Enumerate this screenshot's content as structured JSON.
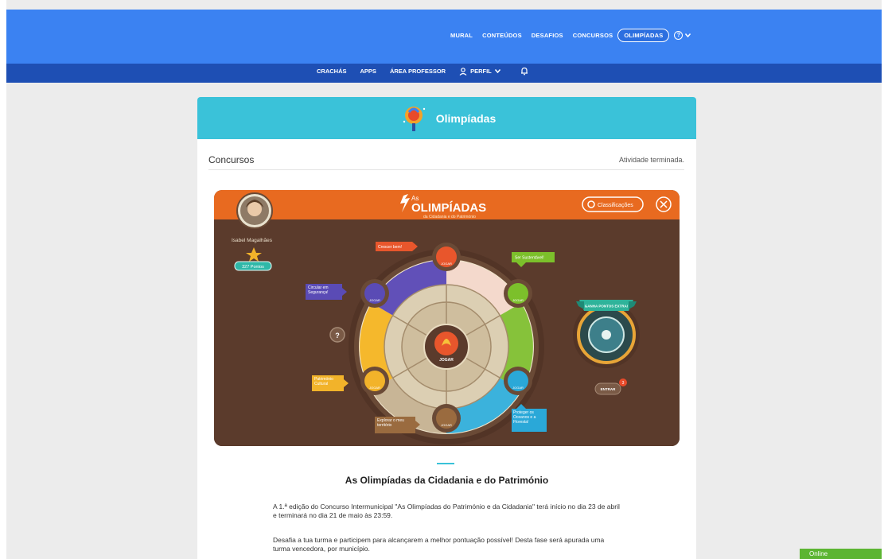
{
  "nav": {
    "items": [
      "MURAL",
      "CONTEÚDOS",
      "DESAFIOS",
      "CONCURSOS",
      "OLIMPÍADAS"
    ],
    "active": "OLIMPÍADAS",
    "help_icon": "question-circle-icon"
  },
  "subnav": {
    "items": [
      "CRACHÁS",
      "APPS",
      "ÁREA PROFESSOR"
    ],
    "profile_label": "PERFIL",
    "bell_icon": "bell-icon"
  },
  "page": {
    "header_title": "Olimpíadas",
    "section_title": "Concursos",
    "status": "Atividade terminada."
  },
  "game": {
    "logo_small": "As",
    "logo_title": "OLIMPÍADAS",
    "logo_subtitle": "da Cidadania e do Património",
    "rankings_label": "Classificações",
    "user_name": "Isabel Magalhães",
    "points_label": "327 Pontos",
    "center_label": "JOGAR",
    "help_mark": "?",
    "extra_banner": "GANHA PONTOS EXTRA!",
    "enter_label": "ENTRAR",
    "enter_badge": "3",
    "nodes": [
      {
        "label": "Crescer bem!",
        "button": "JOGAR",
        "color": "#e8562c"
      },
      {
        "label": "Ser Sustentável!",
        "button": "JOGAR",
        "color": "#7cc02b"
      },
      {
        "label": "Proteger os Oceanos e a Floresta!",
        "button": "JOGAR",
        "color": "#2aa8d8"
      },
      {
        "label": "Explorar o meu território",
        "button": "JOGAR",
        "color": "#9a6b3f"
      },
      {
        "label": "Património Cultural",
        "button": "JOGAR",
        "color": "#f2b32a"
      },
      {
        "label": "Circular em Segurança!",
        "button": "JOGAR",
        "color": "#5a4bb5"
      }
    ]
  },
  "article": {
    "title": "As Olimpíadas da Cidadania e do Património",
    "p1": "A 1.ª edição do Concurso Intermunicipal \"As Olimpíadas do Património e da Cidadania\" terá início no dia 23 de abril e terminará no dia 21 de maio às 23:59.",
    "p2": "Desafia a tua turma e participem para alcançarem a melhor pontuação possível! Desta fase será apurada uma turma vencedora, por município."
  },
  "chat": {
    "label": "Online"
  },
  "colors": {
    "primary": "#3b82f2",
    "secondary": "#1e4fb4",
    "accent": "#3ac2d9",
    "board": "#5b3b2c",
    "orange": "#e86a20"
  }
}
